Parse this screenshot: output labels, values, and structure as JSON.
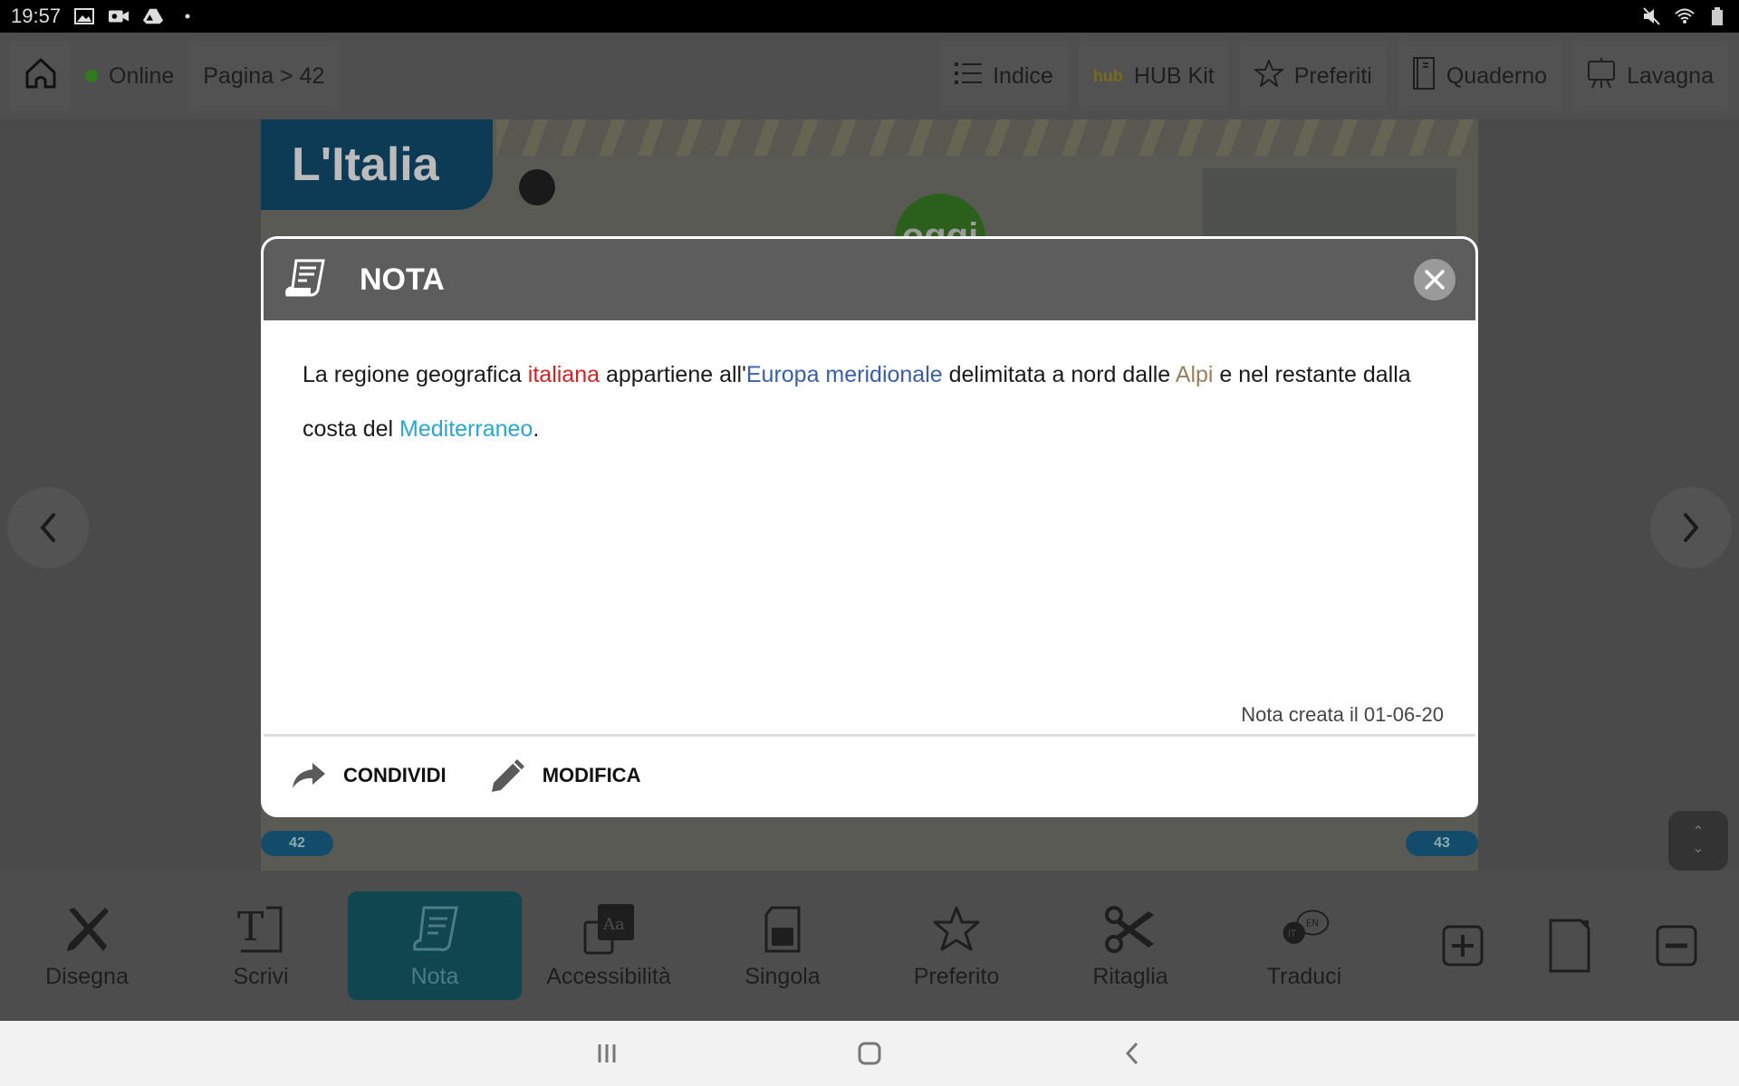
{
  "status_bar": {
    "time": "19:57",
    "left_icons": [
      "gallery-icon",
      "video-icon",
      "drive-icon",
      "dot-icon"
    ],
    "right_icons": [
      "mute-icon",
      "wifi-icon",
      "battery-icon"
    ]
  },
  "top_bar": {
    "home_icon": "home-icon",
    "online_label": "Online",
    "online_color": "#2e7d1c",
    "page_label": "Pagina > 42",
    "right_items": [
      {
        "label": "Indice",
        "icon": "list-icon"
      },
      {
        "label": "HUB Kit",
        "icon": "hub-kit-icon"
      },
      {
        "label": "Preferiti",
        "icon": "star-icon"
      },
      {
        "label": "Quaderno",
        "icon": "notebook-icon"
      },
      {
        "label": "Lavagna",
        "icon": "whiteboard-icon"
      }
    ]
  },
  "book": {
    "title": "L'Italia",
    "oggi_label": "oggi",
    "page_left": "42",
    "page_right": "43"
  },
  "modal": {
    "title": "NOTA",
    "note_segments": [
      {
        "text": "La regione geografica ",
        "color": "default"
      },
      {
        "text": "italiana",
        "color": "red"
      },
      {
        "text": " appartiene all'",
        "color": "default"
      },
      {
        "text": "Europa meridionale",
        "color": "blue"
      },
      {
        "text": " delimitata a nord dalle ",
        "color": "default"
      },
      {
        "text": "Alpi",
        "color": "tan"
      },
      {
        "text": " e nel restante dalla costa del ",
        "color": "default"
      },
      {
        "text": "Mediterraneo",
        "color": "cyan"
      },
      {
        "text": ".",
        "color": "default"
      }
    ],
    "created_label": "Nota creata il 01-06-20",
    "share_label": "CONDIVIDI",
    "edit_label": "MODIFICA",
    "colors": {
      "red": "#d42222",
      "blue": "#3a5fa8",
      "tan": "#9a8060",
      "cyan": "#2aa6d0"
    }
  },
  "toolbar": {
    "tools": [
      {
        "label": "Disegna",
        "icon": "draw-icon",
        "active": false
      },
      {
        "label": "Scrivi",
        "icon": "text-icon",
        "active": false
      },
      {
        "label": "Nota",
        "icon": "note-icon",
        "active": true
      },
      {
        "label": "Accessibilità",
        "icon": "accessibility-icon",
        "active": false
      },
      {
        "label": "Singola",
        "icon": "single-page-icon",
        "active": false
      },
      {
        "label": "Preferito",
        "icon": "star-icon",
        "active": false
      },
      {
        "label": "Ritaglia",
        "icon": "scissors-icon",
        "active": false
      },
      {
        "label": "Traduci",
        "icon": "translate-icon",
        "active": false
      }
    ],
    "translate_badges": [
      "IT",
      "EN"
    ],
    "accent": "#0f4650"
  }
}
